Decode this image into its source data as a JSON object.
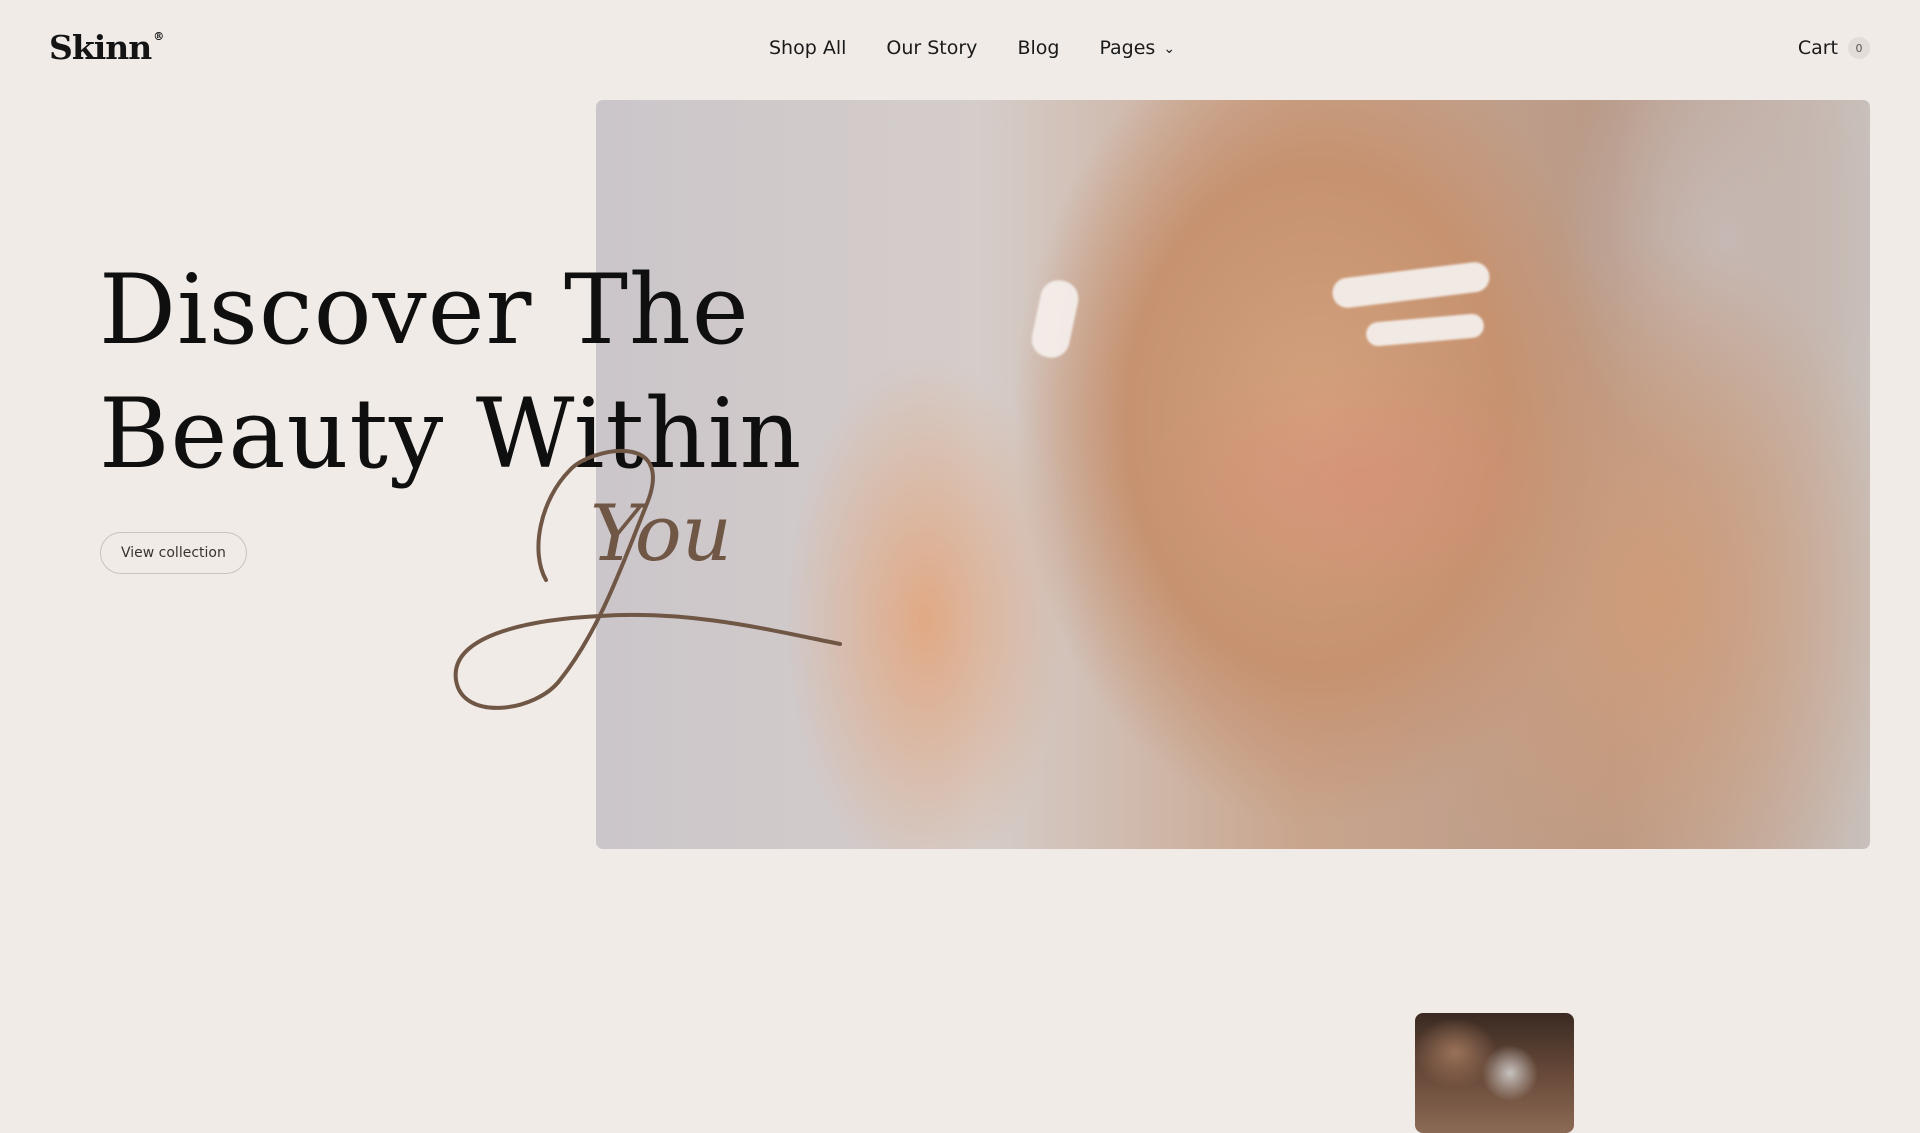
{
  "header": {
    "logo": "Skinn",
    "logo_mark": "®",
    "nav": [
      {
        "label": "Shop All"
      },
      {
        "label": "Our Story"
      },
      {
        "label": "Blog"
      },
      {
        "label": "Pages",
        "icon": "chevron-down-icon",
        "icon_glyph": "⌄"
      }
    ],
    "cart": {
      "label": "Cart",
      "count": "0"
    }
  },
  "hero": {
    "title_line1": "Discover The",
    "title_line2": "Beauty Within",
    "script_word": "You",
    "cta_label": "View collection",
    "image_description": "woman applying face cream"
  },
  "colors": {
    "background": "#f0ebe7",
    "text": "#141414",
    "script_accent": "#6f5645",
    "button_border": "#cbc2ba"
  }
}
